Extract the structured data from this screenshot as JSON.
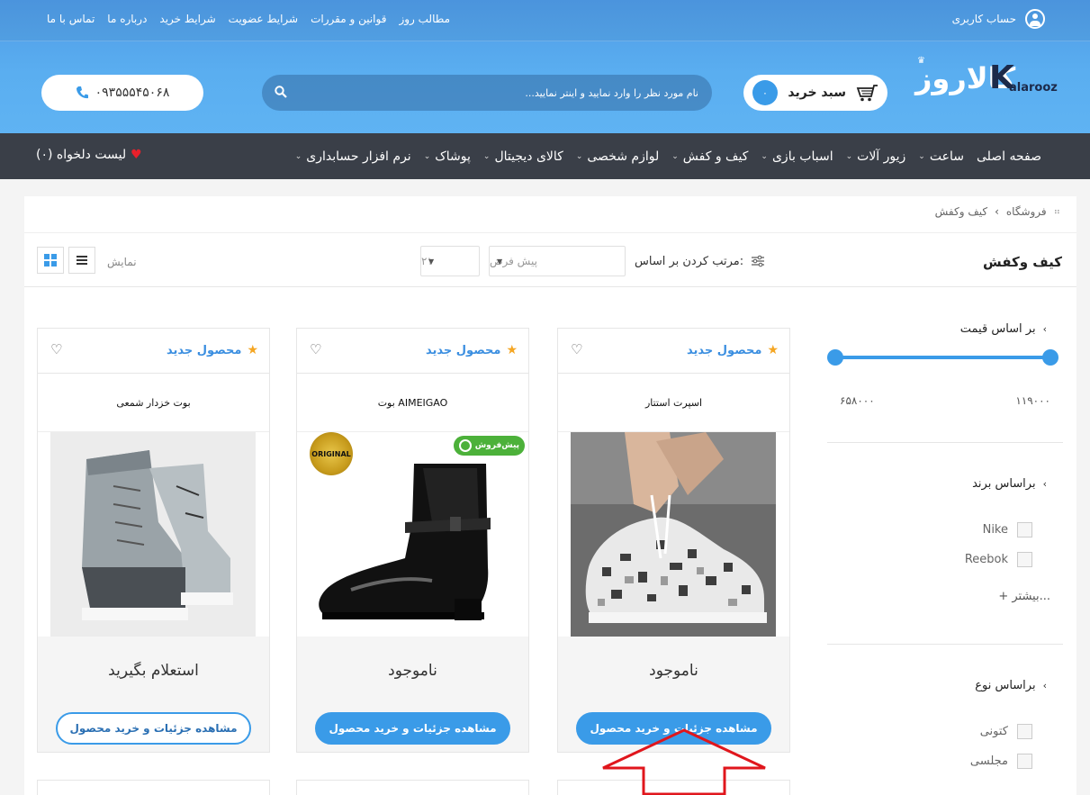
{
  "top_bar": {
    "links": [
      "مطالب روز",
      "قوانین و مقررات",
      "شرایط عضویت",
      "شرایط خرید",
      "درباره ما",
      "تماس با ما"
    ],
    "account_label": "حساب کاربری"
  },
  "header": {
    "logo_text": "KALAROOZ",
    "logo_small": "alarooz",
    "cart_label": "سبد خرید",
    "cart_count": "۰",
    "search_placeholder": "نام مورد نظر را وارد نمایید و اینتر نمایید...",
    "phone": "۰۹۳۵۵۵۴۵۰۶۸"
  },
  "nav": {
    "items": [
      {
        "label": "صفحه اصلی",
        "has_menu": false
      },
      {
        "label": "ساعت",
        "has_menu": true
      },
      {
        "label": "زیور آلات",
        "has_menu": true
      },
      {
        "label": "اسباب بازی",
        "has_menu": true
      },
      {
        "label": "کیف و کفش",
        "has_menu": true
      },
      {
        "label": "لوازم شخصی",
        "has_menu": true
      },
      {
        "label": "کالای دیجیتال",
        "has_menu": true
      },
      {
        "label": "پوشاک",
        "has_menu": true
      },
      {
        "label": "نرم افزار حسابداری",
        "has_menu": true
      }
    ],
    "wishlist_label": "لیست دلخواه (۰)"
  },
  "breadcrumb": {
    "items": [
      "فروشگاه",
      "کیف وکفش"
    ]
  },
  "toolbar": {
    "page_title": "کیف وکفش",
    "sort_label": "مرتب کردن بر اساس:",
    "sort_value": "پیش فرض",
    "per_page_value": "۲۱",
    "view_label": "نمایش"
  },
  "filters": {
    "price": {
      "title": "بر اساس قیمت",
      "min": "۱۱۹۰۰۰",
      "max": "۶۵۸۰۰۰"
    },
    "brand": {
      "title": "براساس برند",
      "options": [
        "Nike",
        "Reebok"
      ],
      "more": "+ بیشتر..."
    },
    "type": {
      "title": "براساس نوع",
      "options": [
        "کتونی",
        "مجلسی"
      ]
    }
  },
  "products": [
    {
      "badge": "محصول جدید",
      "name": "اسپرت استتار",
      "status": "ناموجود",
      "button": "مشاهده جزئیات و خرید محصول"
    },
    {
      "badge": "محصول جدید",
      "name": "بوت AIMEIGAO",
      "status": "ناموجود",
      "button": "مشاهده جزئیات و خرید محصول",
      "presale": "پیش‌فروش",
      "seal": "ORIGINAL"
    },
    {
      "badge": "محصول جدید",
      "name": "بوت خزدار شمعی",
      "status": "استعلام بگیرید",
      "button": "مشاهده جزئیات و خرید محصول"
    }
  ],
  "colors": {
    "accent": "#3a9be8",
    "nav_bg": "#3a3f48",
    "badge_green": "#4cb13a",
    "arrow_red": "#e0161c"
  }
}
